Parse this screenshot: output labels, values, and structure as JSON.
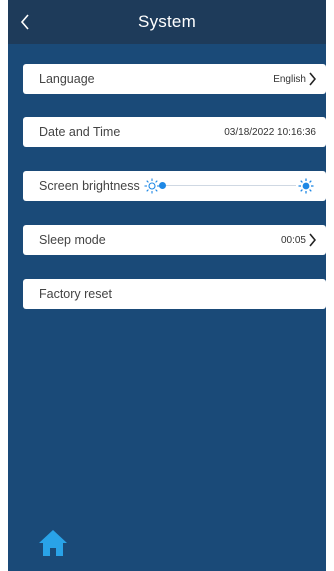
{
  "header": {
    "title": "System"
  },
  "settings": {
    "language": {
      "label": "Language",
      "value": "English"
    },
    "date_time": {
      "label": "Date and Time",
      "value": "03/18/2022 10:16:36"
    },
    "brightness": {
      "label": "Screen brightness",
      "level": 0.0
    },
    "sleep": {
      "label": "Sleep mode",
      "value": "00:05"
    },
    "factory_reset": {
      "label": "Factory reset"
    }
  },
  "colors": {
    "panel": "#1a4a78",
    "header": "#1e3b5a",
    "accent": "#1e88e5",
    "row": "#ffffff"
  },
  "icons": {
    "back": "chevron-left-icon",
    "row_arrow": "chevron-right-icon",
    "brightness_low": "sun-outline-icon",
    "brightness_high": "sun-filled-icon",
    "home": "home-icon"
  }
}
